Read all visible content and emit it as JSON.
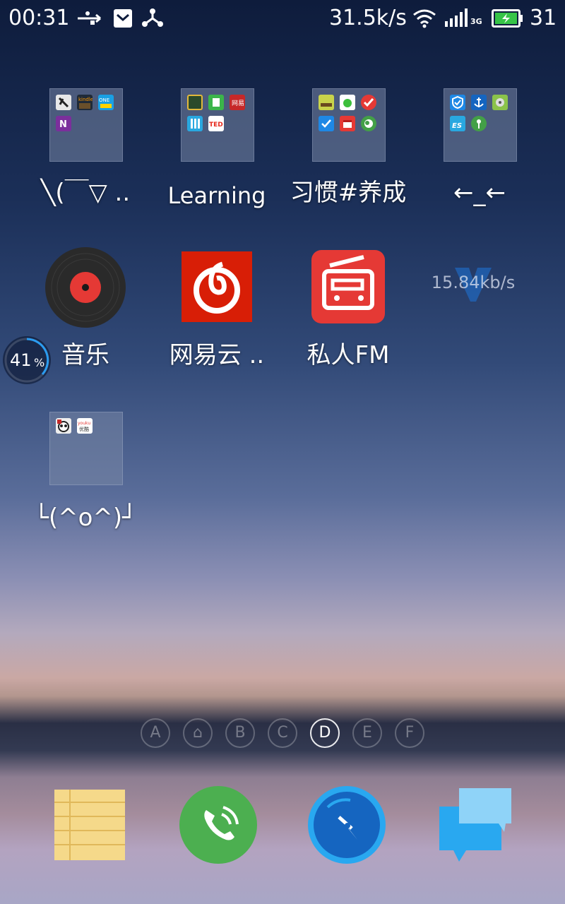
{
  "status_bar": {
    "time": "00:31",
    "net_speed": "31.5k/s",
    "network_type": "3G",
    "battery": "31",
    "icons": [
      "usb-icon",
      "mail-icon",
      "share-icon",
      "wifi-icon",
      "signal-icon",
      "battery-icon"
    ]
  },
  "folders": [
    {
      "label": "╲(￣▽ ..",
      "icons": [
        "black-app-icon",
        "kindle-icon",
        "one-icon",
        "onenote-icon"
      ]
    },
    {
      "label": "Learning",
      "icons": [
        "board-icon",
        "green-note-icon",
        "red-app-icon",
        "blue-grid-icon",
        "ted-icon"
      ]
    },
    {
      "label": "习惯#养成",
      "icons": [
        "yellow-app-icon",
        "green-drop-icon",
        "red-check-icon",
        "blue-check-icon",
        "red-calendar-icon",
        "green-globe-icon"
      ]
    },
    {
      "label": "←_←",
      "icons": [
        "shield-icon",
        "anchor-icon",
        "gear-app-icon",
        "folder-es-icon",
        "green-key-icon"
      ]
    },
    {
      "label": "└(^o^)┘",
      "icons": [
        "panda-icon",
        "youku-icon"
      ]
    }
  ],
  "apps": [
    {
      "label": "音乐",
      "icon": "vinyl-record-icon"
    },
    {
      "label": "网易云 ..",
      "icon": "netease-music-icon"
    },
    {
      "label": "私人FM",
      "icon": "radio-icon"
    }
  ],
  "widgets": {
    "speed": "15.84kb/s",
    "memory_percent": "41",
    "memory_unit": "%"
  },
  "page_indicator": {
    "pages": [
      "A",
      "⌂",
      "B",
      "C",
      "D",
      "E",
      "F"
    ],
    "active": "D"
  },
  "dock": [
    {
      "name": "notes",
      "icon": "notepad-icon"
    },
    {
      "name": "phone",
      "icon": "phone-icon"
    },
    {
      "name": "browser",
      "icon": "compass-icon"
    },
    {
      "name": "messages",
      "icon": "chat-bubbles-icon"
    }
  ],
  "colors": {
    "netease_red": "#d81e06",
    "radio_red": "#e53935",
    "phone_green": "#4caf50",
    "browser_blue": "#1e88e5",
    "chat_blue": "#29a8f0"
  }
}
